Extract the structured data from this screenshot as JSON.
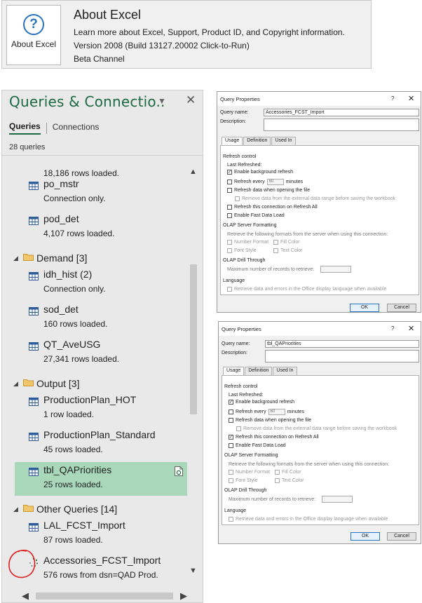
{
  "about": {
    "button_label": "About Excel",
    "title": "About Excel",
    "description": "Learn more about Excel, Support, Product ID, and Copyright information.",
    "version": "Version 2008 (Build 13127.20002 Click-to-Run)",
    "channel": "Beta Channel"
  },
  "queries_pane": {
    "title": "Queries & Connectio..",
    "tabs": {
      "queries": "Queries",
      "connections": "Connections"
    },
    "count": "28 queries",
    "items": [
      {
        "name": "",
        "status": "18,186 rows loaded."
      },
      {
        "name": "po_mstr",
        "status": "Connection only."
      },
      {
        "name": "pod_det",
        "status": "4,107 rows loaded."
      },
      {
        "name": "idh_hist (2)",
        "status": "Connection only."
      },
      {
        "name": "sod_det",
        "status": "160 rows loaded."
      },
      {
        "name": "QT_AveUSG",
        "status": "27,341 rows loaded."
      },
      {
        "name": "ProductionPlan_HOT",
        "status": "1 row loaded."
      },
      {
        "name": "ProductionPlan_Standard",
        "status": "45 rows loaded."
      },
      {
        "name": "tbl_QAPriorities",
        "status": "25 rows loaded."
      },
      {
        "name": "LAL_FCST_Import",
        "status": "87 rows loaded."
      },
      {
        "name": "Accessories_FCST_Import",
        "status": "576 rows from dsn=QAD Prod."
      }
    ],
    "groups": [
      {
        "name": "Demand [3]"
      },
      {
        "name": "Output [3]"
      },
      {
        "name": "Other Queries [14]"
      }
    ]
  },
  "dialog_common": {
    "window_title": "Query Properties",
    "help": "?",
    "close": "✕",
    "query_name_label": "Query name:",
    "description_label": "Description:",
    "tabs": [
      "Usage",
      "Definition",
      "Used In"
    ],
    "refresh_control": "Refresh control",
    "last_refreshed": "Last Refreshed:",
    "enable_background": "Enable background refresh",
    "refresh_every": "Refresh every",
    "refresh_minutes_value": "60",
    "minutes": "minutes",
    "refresh_on_open": "Refresh data when opening the file",
    "remove_external": "Remove data from the external data range before saving the workbook",
    "refresh_all": "Refresh this connection on Refresh All",
    "fast_load": "Enable Fast Data Load",
    "olap_formatting": "OLAP Server Formatting",
    "olap_retrieve": "Retrieve the following formats from the server when using this connection:",
    "number_format": "Number Format",
    "fill_color": "Fill Color",
    "font_style": "Font Style",
    "text_color": "Text Color",
    "olap_drill": "OLAP Drill Through",
    "max_records": "Maximum number of records to retrieve:",
    "language": "Language",
    "language_option": "Retrieve data and errors in the Office display language when available",
    "ok": "OK",
    "cancel": "Cancel"
  },
  "dialog1": {
    "query_name": "Accessories_FCST_Import",
    "checks": {
      "background": true,
      "refresh_every": false,
      "on_open": false,
      "remove_external": false,
      "refresh_all": false,
      "fast_load": false
    }
  },
  "dialog2": {
    "query_name": "tbl_QAPriorities",
    "checks": {
      "background": true,
      "refresh_every": false,
      "on_open": false,
      "remove_external": false,
      "refresh_all": true,
      "fast_load": false
    }
  },
  "colors": {
    "brand_green": "#1d6a42",
    "selected_row": "#a8d8b9",
    "annotation_red": "#e02020"
  }
}
